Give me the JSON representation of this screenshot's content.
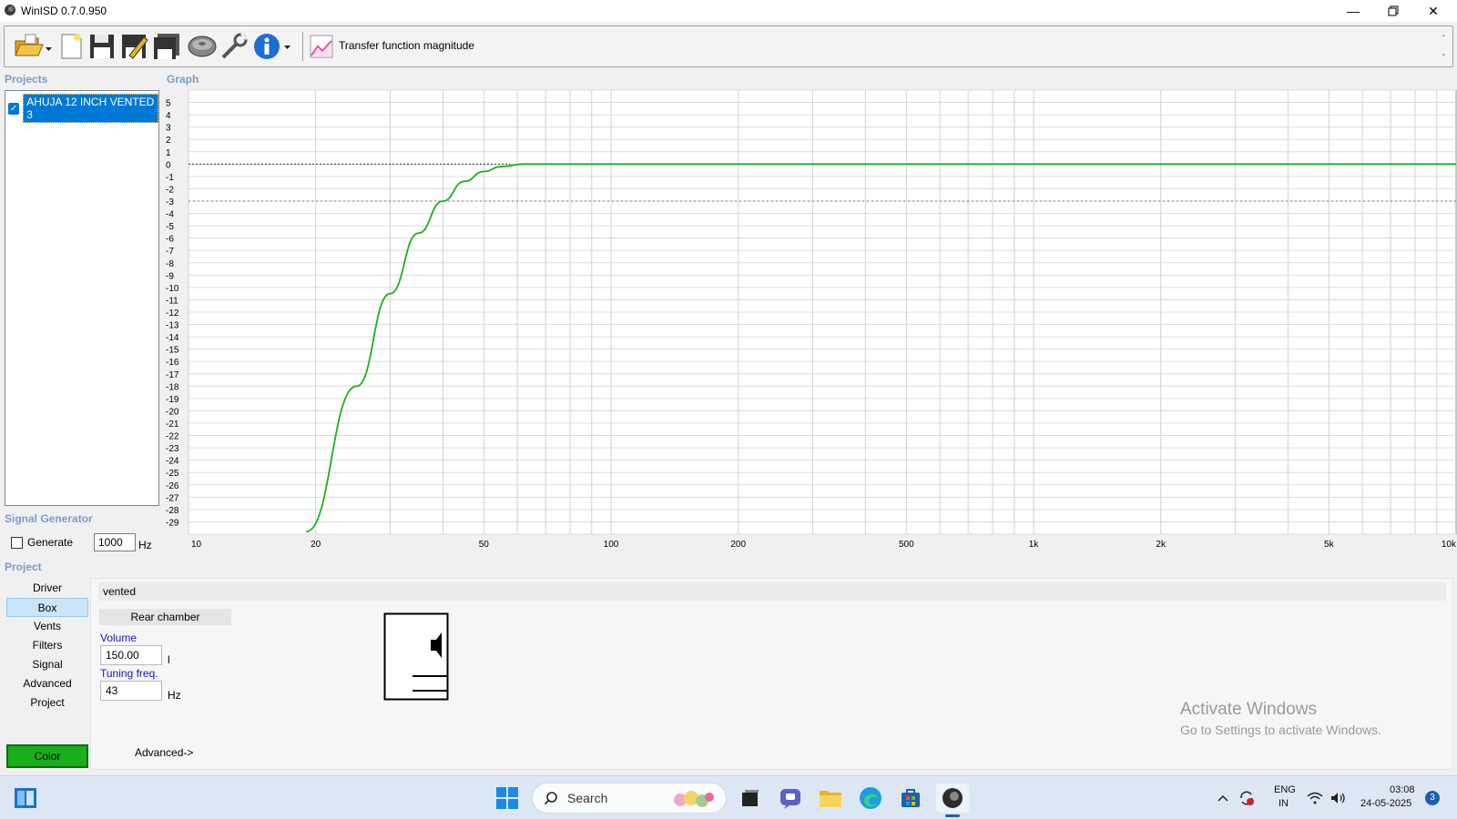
{
  "window": {
    "title": "WinISD 0.7.0.950"
  },
  "toolbar": {
    "view_label": "Transfer function magnitude",
    "buttons": [
      "open-folder",
      "new-project",
      "save",
      "save-as",
      "save-all",
      "speaker-driver",
      "tools",
      "info"
    ]
  },
  "projects": {
    "label": "Projects",
    "items": [
      {
        "name": "AHUJA 12 INCH VENTED 3",
        "checked": true
      }
    ]
  },
  "graph": {
    "label": "Graph",
    "y_ticks": [
      "5",
      "4",
      "3",
      "2",
      "1",
      "0",
      "-1",
      "-2",
      "-3",
      "-4",
      "-5",
      "-6",
      "-7",
      "-8",
      "-9",
      "-10",
      "-11",
      "-12",
      "-13",
      "-14",
      "-15",
      "-16",
      "-17",
      "-18",
      "-19",
      "-20",
      "-21",
      "-22",
      "-23",
      "-24",
      "-25",
      "-26",
      "-27",
      "-28",
      "-29"
    ],
    "x_ticks": [
      "10",
      "20",
      "50",
      "100",
      "200",
      "500",
      "1k",
      "2k",
      "5k",
      "10k"
    ],
    "curve_color": "#19b219",
    "curve_points": [
      [
        19,
        -29.8
      ],
      [
        25,
        -18
      ],
      [
        30,
        -10.5
      ],
      [
        35,
        -5.6
      ],
      [
        40,
        -3
      ],
      [
        45,
        -1.4
      ],
      [
        50,
        -0.6
      ],
      [
        55,
        -0.2
      ],
      [
        62,
        0
      ],
      [
        10000,
        0
      ]
    ]
  },
  "signal_generator": {
    "label": "Signal Generator",
    "generate_label": "Generate",
    "generate_checked": false,
    "frequency": "1000",
    "unit": "Hz"
  },
  "project_nav": {
    "label": "Project",
    "items": [
      "Driver",
      "Box",
      "Vents",
      "Filters",
      "Signal",
      "Advanced",
      "Project"
    ],
    "active": "Box",
    "color_button": "Color",
    "color": "#1aae1a"
  },
  "box_panel": {
    "type": "vented",
    "chamber_label": "Rear chamber",
    "volume_label": "Volume",
    "volume_value": "150.00",
    "volume_unit": "l",
    "tuning_label": "Tuning freq.",
    "tuning_value": "43",
    "tuning_unit": "Hz",
    "advanced_link": "Advanced->"
  },
  "watermark": {
    "line1": "Activate Windows",
    "line2": "Go to Settings to activate Windows."
  },
  "taskbar": {
    "search_placeholder": "Search",
    "lang1": "ENG",
    "lang2": "IN",
    "time": "03:08",
    "date": "24-05-2025",
    "notifications": "3"
  }
}
